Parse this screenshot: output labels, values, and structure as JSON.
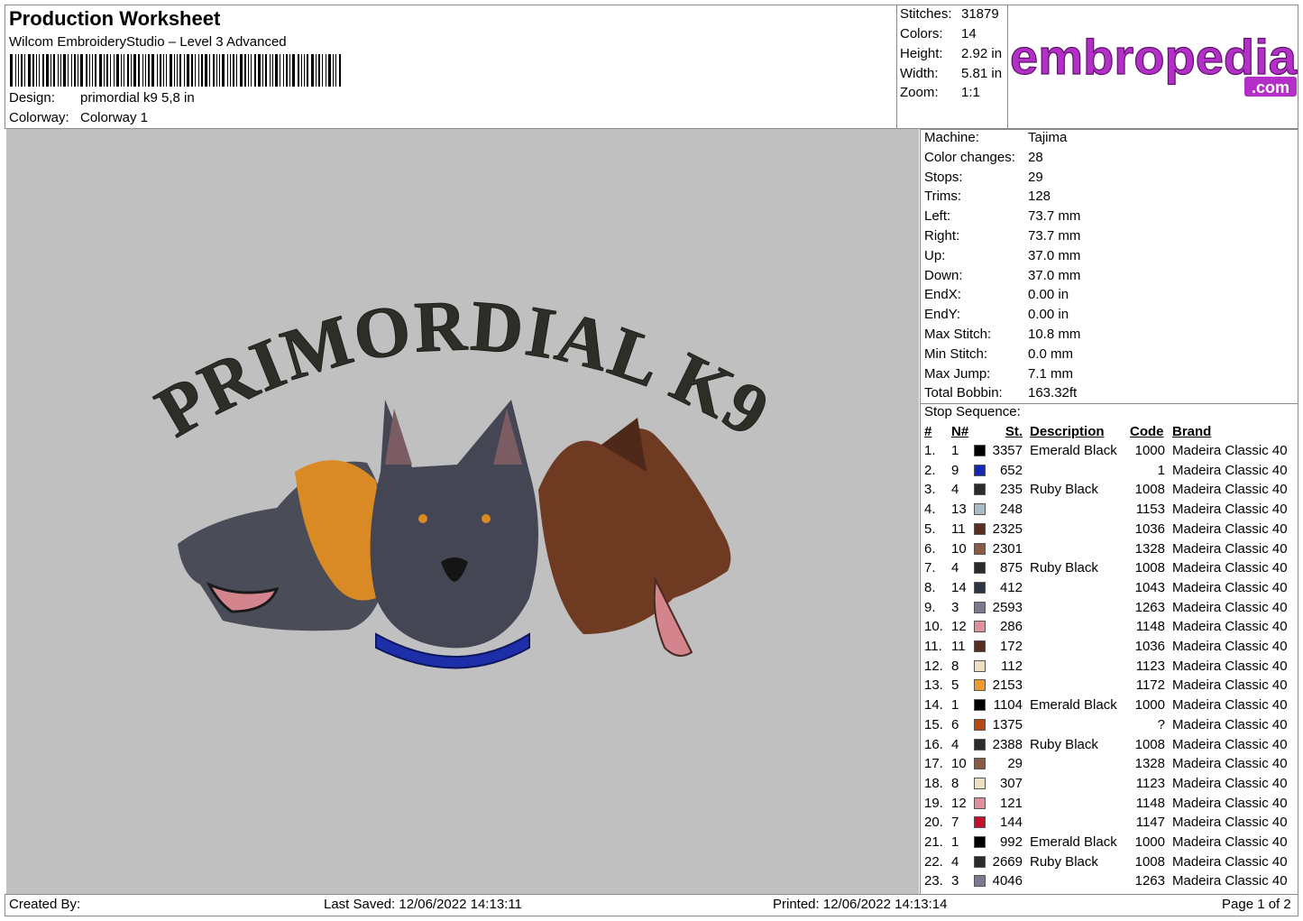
{
  "header": {
    "title": "Production Worksheet",
    "software": "Wilcom EmbroideryStudio – Level 3 Advanced",
    "design_label": "Design:",
    "design_value": "primordial k9 5,8 in",
    "colorway_label": "Colorway:",
    "colorway_value": "Colorway 1"
  },
  "summary": [
    {
      "label": "Stitches:",
      "value": "31879"
    },
    {
      "label": "Colors:",
      "value": "14"
    },
    {
      "label": "Height:",
      "value": "2.92 in"
    },
    {
      "label": "Width:",
      "value": "5.81 in"
    },
    {
      "label": "Zoom:",
      "value": "1:1"
    }
  ],
  "logo": {
    "main": "embropedia",
    "sub": ".com",
    "main_color": "#b42fc8",
    "sub_color": "#b42fc8"
  },
  "design": {
    "text": "PRIMORDIAL K9",
    "colors": {
      "text": "#2e2e28",
      "background": "#c0c0c0",
      "collar": "#1c2fa8",
      "tongue": "#d4848c"
    }
  },
  "machine_info": [
    {
      "label": "Machine:",
      "value": "Tajima"
    },
    {
      "label": "Color changes:",
      "value": "28"
    },
    {
      "label": "Stops:",
      "value": "29"
    },
    {
      "label": "Trims:",
      "value": "128"
    },
    {
      "label": "Left:",
      "value": "73.7 mm"
    },
    {
      "label": "Right:",
      "value": "73.7 mm"
    },
    {
      "label": "Up:",
      "value": "37.0 mm"
    },
    {
      "label": "Down:",
      "value": "37.0 mm"
    },
    {
      "label": "EndX:",
      "value": "0.00 in"
    },
    {
      "label": "EndY:",
      "value": "0.00 in"
    },
    {
      "label": "Max Stitch:",
      "value": "10.8 mm"
    },
    {
      "label": "Min Stitch:",
      "value": "0.0 mm"
    },
    {
      "label": "Max Jump:",
      "value": "7.1 mm"
    },
    {
      "label": "Total Bobbin:",
      "value": "163.32ft"
    }
  ],
  "stop_sequence": {
    "title": "Stop Sequence:",
    "headers": {
      "idx": "#",
      "n": "N#",
      "st": "St.",
      "desc": "Description",
      "code": "Code",
      "brand": "Brand"
    },
    "rows": [
      {
        "idx": "1.",
        "n": "1",
        "color": "#000000",
        "st": "3357",
        "desc": "Emerald Black",
        "code": "1000",
        "brand": "Madeira Classic 40"
      },
      {
        "idx": "2.",
        "n": "9",
        "color": "#1426b4",
        "st": "652",
        "desc": "",
        "code": "1",
        "brand": "Madeira Classic 40"
      },
      {
        "idx": "3.",
        "n": "4",
        "color": "#2b2b2b",
        "st": "235",
        "desc": "Ruby Black",
        "code": "1008",
        "brand": "Madeira Classic 40"
      },
      {
        "idx": "4.",
        "n": "13",
        "color": "#a9bcc8",
        "st": "248",
        "desc": "",
        "code": "1153",
        "brand": "Madeira Classic 40"
      },
      {
        "idx": "5.",
        "n": "11",
        "color": "#5a2e1e",
        "st": "2325",
        "desc": "",
        "code": "1036",
        "brand": "Madeira Classic 40"
      },
      {
        "idx": "6.",
        "n": "10",
        "color": "#8a5a44",
        "st": "2301",
        "desc": "",
        "code": "1328",
        "brand": "Madeira Classic 40"
      },
      {
        "idx": "7.",
        "n": "4",
        "color": "#2b2b2b",
        "st": "875",
        "desc": "Ruby Black",
        "code": "1008",
        "brand": "Madeira Classic 40"
      },
      {
        "idx": "8.",
        "n": "14",
        "color": "#2e3444",
        "st": "412",
        "desc": "",
        "code": "1043",
        "brand": "Madeira Classic 40"
      },
      {
        "idx": "9.",
        "n": "3",
        "color": "#7c7890",
        "st": "2593",
        "desc": "",
        "code": "1263",
        "brand": "Madeira Classic 40"
      },
      {
        "idx": "10.",
        "n": "12",
        "color": "#e0909c",
        "st": "286",
        "desc": "",
        "code": "1148",
        "brand": "Madeira Classic 40"
      },
      {
        "idx": "11.",
        "n": "11",
        "color": "#5a2e1e",
        "st": "172",
        "desc": "",
        "code": "1036",
        "brand": "Madeira Classic 40"
      },
      {
        "idx": "12.",
        "n": "8",
        "color": "#ece0c0",
        "st": "112",
        "desc": "",
        "code": "1123",
        "brand": "Madeira Classic 40"
      },
      {
        "idx": "13.",
        "n": "5",
        "color": "#ee9a2c",
        "st": "2153",
        "desc": "",
        "code": "1172",
        "brand": "Madeira Classic 40"
      },
      {
        "idx": "14.",
        "n": "1",
        "color": "#000000",
        "st": "1104",
        "desc": "Emerald Black",
        "code": "1000",
        "brand": "Madeira Classic 40"
      },
      {
        "idx": "15.",
        "n": "6",
        "color": "#b84810",
        "st": "1375",
        "desc": "",
        "code": "?",
        "brand": "Madeira Classic 40"
      },
      {
        "idx": "16.",
        "n": "4",
        "color": "#2b2b2b",
        "st": "2388",
        "desc": "Ruby Black",
        "code": "1008",
        "brand": "Madeira Classic 40"
      },
      {
        "idx": "17.",
        "n": "10",
        "color": "#8a5a44",
        "st": "29",
        "desc": "",
        "code": "1328",
        "brand": "Madeira Classic 40"
      },
      {
        "idx": "18.",
        "n": "8",
        "color": "#ece0c0",
        "st": "307",
        "desc": "",
        "code": "1123",
        "brand": "Madeira Classic 40"
      },
      {
        "idx": "19.",
        "n": "12",
        "color": "#e0909c",
        "st": "121",
        "desc": "",
        "code": "1148",
        "brand": "Madeira Classic 40"
      },
      {
        "idx": "20.",
        "n": "7",
        "color": "#c4102c",
        "st": "144",
        "desc": "",
        "code": "1147",
        "brand": "Madeira Classic 40"
      },
      {
        "idx": "21.",
        "n": "1",
        "color": "#000000",
        "st": "992",
        "desc": "Emerald Black",
        "code": "1000",
        "brand": "Madeira Classic 40"
      },
      {
        "idx": "22.",
        "n": "4",
        "color": "#2b2b2b",
        "st": "2669",
        "desc": "Ruby Black",
        "code": "1008",
        "brand": "Madeira Classic 40"
      },
      {
        "idx": "23.",
        "n": "3",
        "color": "#7c7890",
        "st": "4046",
        "desc": "",
        "code": "1263",
        "brand": "Madeira Classic 40"
      }
    ]
  },
  "footer": {
    "created_by": "Created By:",
    "last_saved": "Last Saved: 12/06/2022 14:13:11",
    "printed": "Printed: 12/06/2022 14:13:14",
    "page": "Page 1 of 2"
  }
}
